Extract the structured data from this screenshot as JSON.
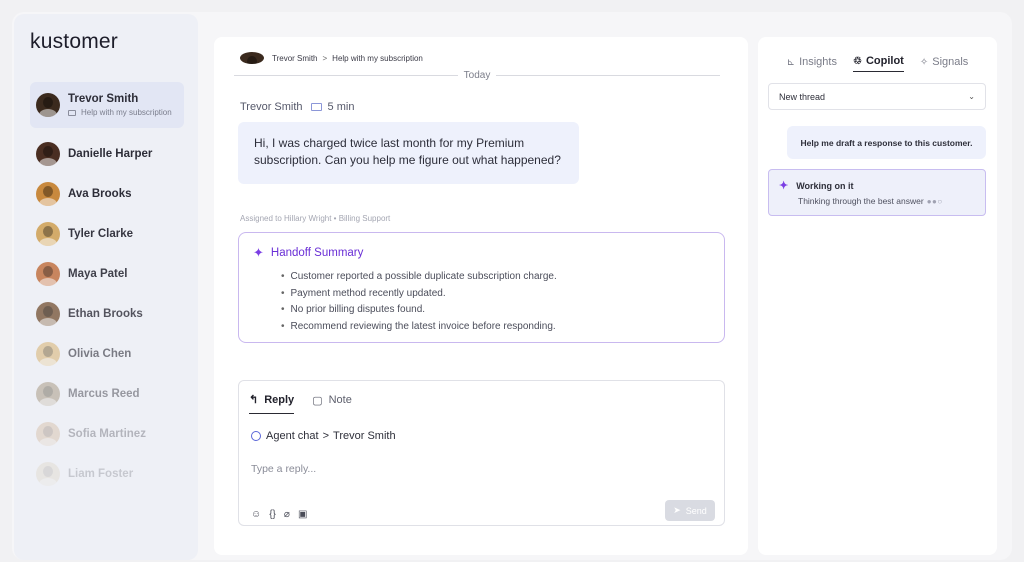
{
  "app": {
    "logo": "kustomer"
  },
  "colors": {
    "accent_purple": "#7b3fe4",
    "active_contact_bg": "#e2e6f4",
    "bubble_bg": "#eef1fc"
  },
  "sidebar": {
    "contacts": [
      {
        "name": "Trevor Smith",
        "subtitle": "Help with my subscription",
        "active": true,
        "avatar_color": "#3b2a1e",
        "opacity": 1
      },
      {
        "name": "Danielle Harper",
        "avatar_color": "#4a2e22",
        "opacity": 1
      },
      {
        "name": "Ava Brooks",
        "avatar_color": "#c8893e",
        "opacity": 1
      },
      {
        "name": "Tyler Clarke",
        "avatar_color": "#d2a863",
        "opacity": 0.95
      },
      {
        "name": "Maya Patel",
        "avatar_color": "#c47a4e",
        "opacity": 0.9
      },
      {
        "name": "Ethan Brooks",
        "avatar_color": "#7a5a3e",
        "opacity": 0.8
      },
      {
        "name": "Olivia Chen",
        "avatar_color": "#d9b77a",
        "opacity": 0.6
      },
      {
        "name": "Marcus Reed",
        "avatar_color": "#9c8a6e",
        "opacity": 0.45
      },
      {
        "name": "Sofia Martinez",
        "avatar_color": "#c9a27c",
        "opacity": 0.3
      },
      {
        "name": "Liam Foster",
        "avatar_color": "#cdbb98",
        "opacity": 0.2
      }
    ]
  },
  "conversation": {
    "breadcrumb": {
      "contact": "Trevor Smith",
      "separator": ">",
      "topic": "Help with my subscription"
    },
    "date_divider": "Today",
    "message": {
      "author": "Trevor Smith",
      "time": "5 min",
      "text": "Hi, I was charged twice last month for my Premium subscription. Can you help me figure out what happened?"
    },
    "assigned": "Assigned to Hillary Wright • Billing Support",
    "handoff": {
      "title": "Handoff Summary",
      "items": [
        "Customer reported a possible duplicate subscription charge.",
        "Payment method recently updated.",
        "No prior billing disputes found.",
        "Recommend reviewing the latest invoice before responding."
      ]
    }
  },
  "reply_box": {
    "tab_reply": "Reply",
    "tab_note": "Note",
    "channel": "Agent chat",
    "channel_sep": ">",
    "recipient": "Trevor Smith",
    "placeholder": "Type a reply...",
    "send_label": "Send",
    "tools": [
      "emoji-icon",
      "variables-icon",
      "attachment-icon",
      "media-icon"
    ]
  },
  "copilot_panel": {
    "tabs": {
      "insights": "Insights",
      "copilot": "Copilot",
      "signals": "Signals"
    },
    "thread_select": "New thread",
    "user_prompt": "Help me draft a response to this customer.",
    "status": {
      "title": "Working on it",
      "subtitle": "Thinking through the best answer"
    }
  }
}
